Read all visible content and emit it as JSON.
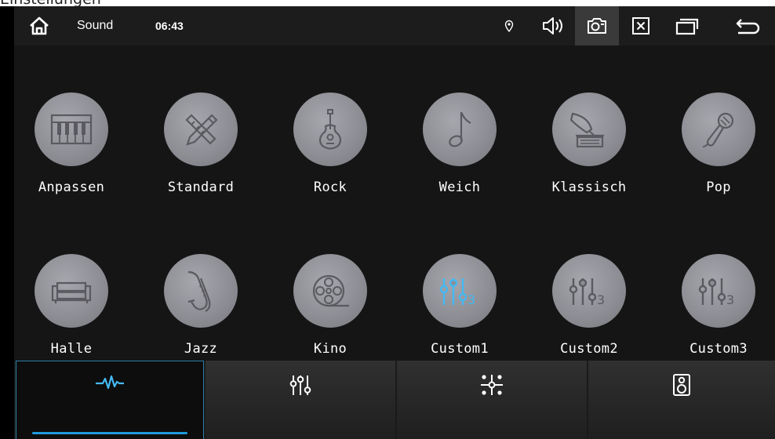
{
  "window_title": "Einstellungen",
  "status_bar": {
    "home_icon": "home-icon",
    "title": "Sound",
    "clock": "06:43",
    "icons": [
      "location-icon",
      "volume-icon",
      "screenshot-icon",
      "close-icon",
      "recent-apps-icon",
      "back-icon"
    ],
    "active_icon": "screenshot-icon"
  },
  "sound_modes": [
    {
      "label": "Anpassen",
      "icon": "piano-icon"
    },
    {
      "label": "Standard",
      "icon": "pencil-ruler-icon"
    },
    {
      "label": "Rock",
      "icon": "guitar-icon"
    },
    {
      "label": "Weich",
      "icon": "music-note-icon"
    },
    {
      "label": "Klassisch",
      "icon": "gramophone-icon"
    },
    {
      "label": "Pop",
      "icon": "microphone-icon"
    },
    {
      "label": "Halle",
      "icon": "sofa-icon"
    },
    {
      "label": "Jazz",
      "icon": "saxophone-icon"
    },
    {
      "label": "Kino",
      "icon": "film-reel-icon"
    },
    {
      "label": "Custom1",
      "icon": "equalizer-custom-icon",
      "selected": true
    },
    {
      "label": "Custom2",
      "icon": "equalizer-custom-icon"
    },
    {
      "label": "Custom3",
      "icon": "equalizer-custom-icon"
    }
  ],
  "bottom_tabs": [
    {
      "icon": "waveform-icon",
      "active": true
    },
    {
      "icon": "equalizer-sliders-icon"
    },
    {
      "icon": "balance-fader-icon"
    },
    {
      "icon": "speaker-icon"
    }
  ],
  "colors": {
    "accent": "#1e9bdc",
    "selected_icon": "#43b9f2",
    "circle": "#8c8c93",
    "background": "#151515"
  }
}
